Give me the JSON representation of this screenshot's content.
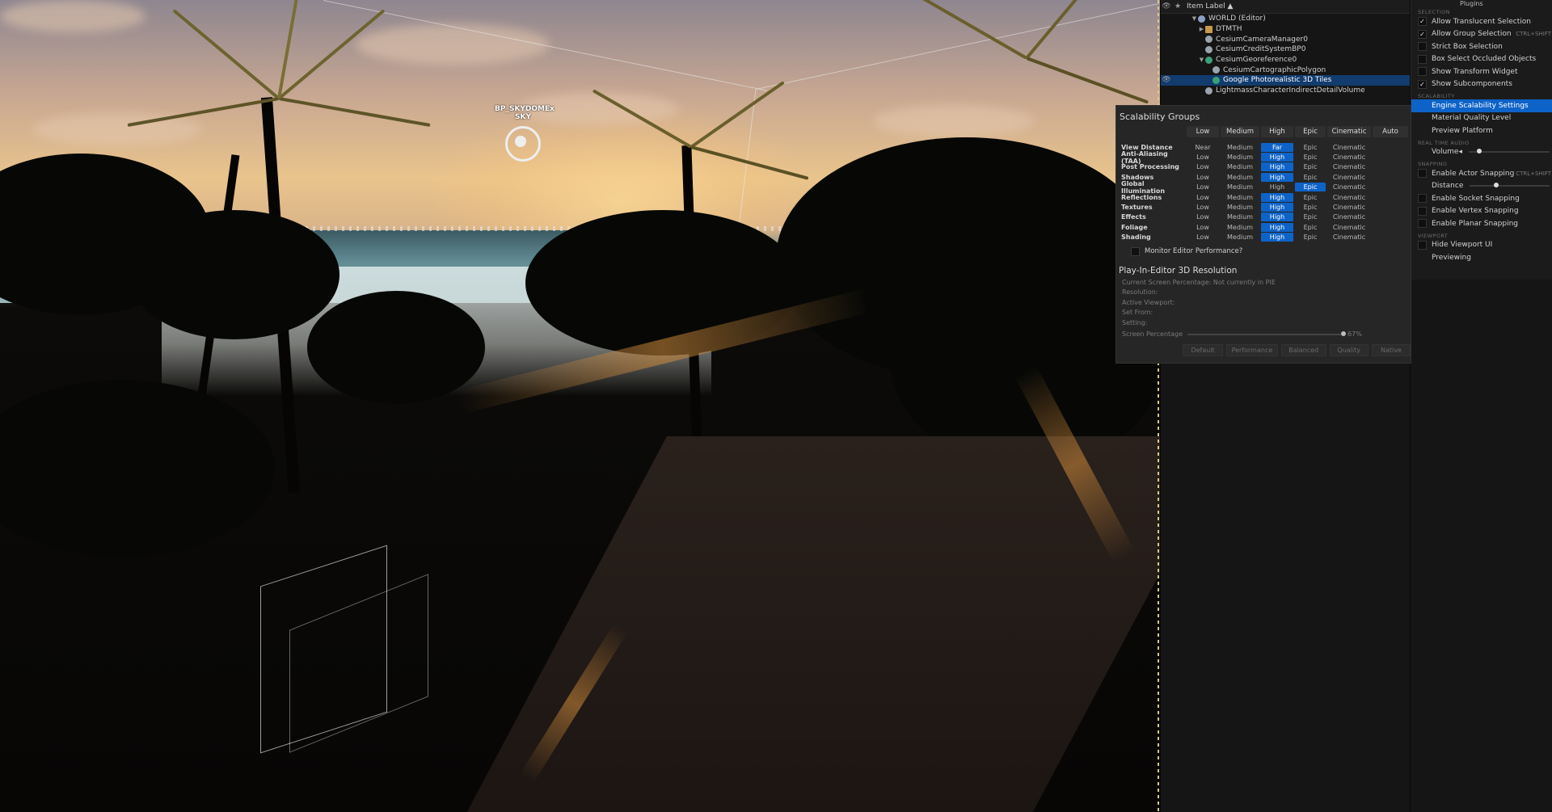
{
  "viewport": {
    "sky_label_top": "BP_SKYDOMEx",
    "sky_label_bottom": "SKY"
  },
  "outliner": {
    "header": {
      "item_label": "Item Label ▲"
    },
    "rows": [
      {
        "label": "WORLD (Editor)",
        "icon": "world-icon",
        "indent": 1,
        "twisty": "▼"
      },
      {
        "label": "DTMTH",
        "icon": "folder-icon",
        "indent": 2,
        "twisty": "▶"
      },
      {
        "label": "CesiumCameraManager0",
        "icon": "actor-icon",
        "indent": 2,
        "twisty": ""
      },
      {
        "label": "CesiumCreditSystemBP0",
        "icon": "actor-icon",
        "indent": 2,
        "twisty": ""
      },
      {
        "label": "CesiumGeoreference0",
        "icon": "georeference-icon",
        "indent": 2,
        "twisty": "▼"
      },
      {
        "label": "CesiumCartographicPolygon",
        "icon": "actor-icon",
        "indent": 3,
        "twisty": ""
      },
      {
        "label": "Google Photorealistic 3D Tiles",
        "icon": "tileset-icon",
        "indent": 3,
        "twisty": "",
        "selected": true
      },
      {
        "label": "LightmassCharacterIndirectDetailVolume",
        "icon": "actor-icon",
        "indent": 2,
        "twisty": ""
      }
    ]
  },
  "settings_menu": {
    "top_item": "Plugins",
    "sections": [
      {
        "title": "SELECTION",
        "items": [
          {
            "label": "Allow Translucent Selection",
            "checked": true
          },
          {
            "label": "Allow Group Selection",
            "checked": true,
            "shortcut": "CTRL+SHIFT"
          },
          {
            "label": "Strict Box Selection",
            "checked": false
          },
          {
            "label": "Box Select Occluded Objects",
            "checked": false
          },
          {
            "label": "Show Transform Widget",
            "checked": false
          },
          {
            "label": "Show Subcomponents",
            "checked": true
          }
        ]
      },
      {
        "title": "SCALABILITY",
        "items": [
          {
            "label": "Engine Scalability Settings",
            "highlight": true
          },
          {
            "label": "Material Quality Level"
          },
          {
            "label": "Preview Platform"
          }
        ]
      },
      {
        "title": "REAL TIME AUDIO",
        "items": [
          {
            "label": "Volume",
            "slider": 0.1
          }
        ]
      },
      {
        "title": "SNAPPING",
        "items": [
          {
            "label": "Enable Actor Snapping",
            "checked": false,
            "shortcut": "CTRL+SHIFT"
          },
          {
            "label": "Distance",
            "slider": 0.3
          },
          {
            "label": "Enable Socket Snapping",
            "checked": false
          },
          {
            "label": "Enable Vertex Snapping",
            "checked": false
          },
          {
            "label": "Enable Planar Snapping",
            "checked": false
          }
        ]
      },
      {
        "title": "VIEWPORT",
        "items": [
          {
            "label": "Hide Viewport UI",
            "checked": false
          },
          {
            "label": "Previewing"
          }
        ]
      }
    ]
  },
  "scalability": {
    "title": "Scalability Groups",
    "columns": [
      "Low",
      "Medium",
      "High",
      "Epic",
      "Cinematic",
      "Auto"
    ],
    "rows": [
      {
        "name": "View Distance",
        "cells": [
          "Near",
          "Medium",
          "Far",
          "Epic",
          "Cinematic"
        ],
        "selected": 2
      },
      {
        "name": "Anti-Aliasing (TAA)",
        "cells": [
          "Low",
          "Medium",
          "High",
          "Epic",
          "Cinematic"
        ],
        "selected": 2
      },
      {
        "name": "Post Processing",
        "cells": [
          "Low",
          "Medium",
          "High",
          "Epic",
          "Cinematic"
        ],
        "selected": 2
      },
      {
        "name": "Shadows",
        "cells": [
          "Low",
          "Medium",
          "High",
          "Epic",
          "Cinematic"
        ],
        "selected": 2
      },
      {
        "name": "Global Illumination",
        "cells": [
          "Low",
          "Medium",
          "High",
          "Epic",
          "Cinematic"
        ],
        "selected": 3
      },
      {
        "name": "Reflections",
        "cells": [
          "Low",
          "Medium",
          "High",
          "Epic",
          "Cinematic"
        ],
        "selected": 2
      },
      {
        "name": "Textures",
        "cells": [
          "Low",
          "Medium",
          "High",
          "Epic",
          "Cinematic"
        ],
        "selected": 2
      },
      {
        "name": "Effects",
        "cells": [
          "Low",
          "Medium",
          "High",
          "Epic",
          "Cinematic"
        ],
        "selected": 2
      },
      {
        "name": "Foliage",
        "cells": [
          "Low",
          "Medium",
          "High",
          "Epic",
          "Cinematic"
        ],
        "selected": 2
      },
      {
        "name": "Shading",
        "cells": [
          "Low",
          "Medium",
          "High",
          "Epic",
          "Cinematic"
        ],
        "selected": 2
      }
    ],
    "monitor_label": "Monitor Editor Performance?",
    "pie": {
      "title": "Play-In-Editor 3D Resolution",
      "lines": [
        "Current Screen Percentage: Not currently in PIE",
        "Resolution:",
        "Active Viewport:",
        "Set From:",
        "Setting:"
      ],
      "screen_percentage_label": "Screen Percentage",
      "screen_percentage_value": "67%",
      "buttons": [
        "Default",
        "Performance",
        "Balanced",
        "Quality",
        "Native"
      ]
    }
  }
}
